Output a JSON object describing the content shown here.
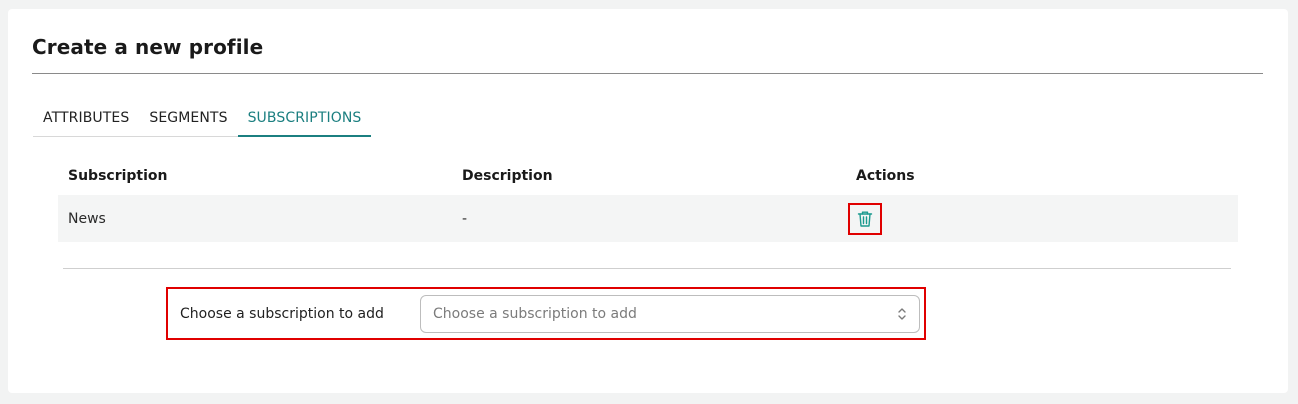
{
  "page": {
    "title": "Create a new profile"
  },
  "tabs": [
    {
      "label": "ATTRIBUTES",
      "active": false
    },
    {
      "label": "SEGMENTS",
      "active": false
    },
    {
      "label": "SUBSCRIPTIONS",
      "active": true
    }
  ],
  "table": {
    "headers": [
      "Subscription",
      "Description",
      "Actions"
    ],
    "rows": [
      {
        "subscription": "News",
        "description": "-",
        "action_icon": "trash-icon"
      }
    ]
  },
  "add_subscription": {
    "label": "Choose a subscription to add",
    "placeholder": "Choose a subscription to add",
    "icon": "chevron-up-down-icon"
  },
  "colors": {
    "accent": "#1b7f80",
    "highlight": "#e00000",
    "background": "#f2f3f3"
  }
}
